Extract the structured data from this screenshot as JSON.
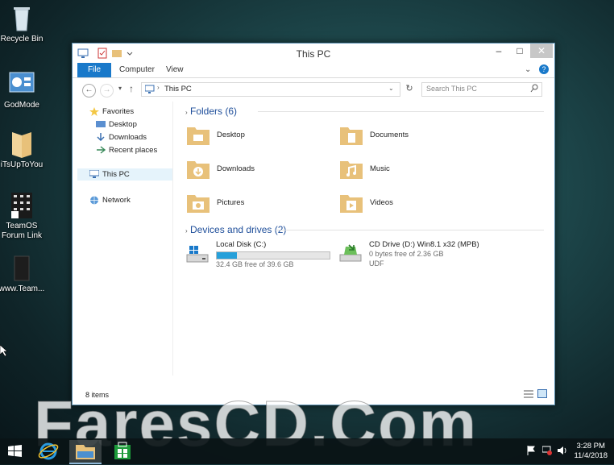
{
  "desktop": {
    "icons": [
      {
        "label": "Recycle Bin"
      },
      {
        "label": "GodMode"
      },
      {
        "label": "iTsUpToYou"
      },
      {
        "label": "TeamOS Forum Link"
      },
      {
        "label": "www.Team..."
      }
    ]
  },
  "window": {
    "title": "This PC",
    "ribbon_tabs": [
      "File",
      "Computer",
      "View"
    ],
    "address": "This PC",
    "search_placeholder": "Search This PC",
    "nav": {
      "favorites": "Favorites",
      "desktop": "Desktop",
      "downloads": "Downloads",
      "recent": "Recent places",
      "this_pc": "This PC",
      "network": "Network"
    },
    "folders_header": "Folders (6)",
    "folders": [
      "Desktop",
      "Documents",
      "Downloads",
      "Music",
      "Pictures",
      "Videos"
    ],
    "devices_header": "Devices and drives (2)",
    "drives": [
      {
        "name": "Local Disk (C:)",
        "detail": "32.4 GB free of 39.6 GB",
        "used_fraction": 0.18
      },
      {
        "name": "CD Drive (D:) Win8.1 x32 (MPB)",
        "detail": "0 bytes free of 2.36 GB",
        "fs": "UDF"
      }
    ],
    "status": "8 items"
  },
  "taskbar": {
    "time": "3:28 PM",
    "date": "11/4/2018"
  },
  "watermark": "FaresCD.Com",
  "colors": {
    "accent": "#1979ca",
    "folder": "#e8c17a",
    "progress": "#26a0da"
  }
}
